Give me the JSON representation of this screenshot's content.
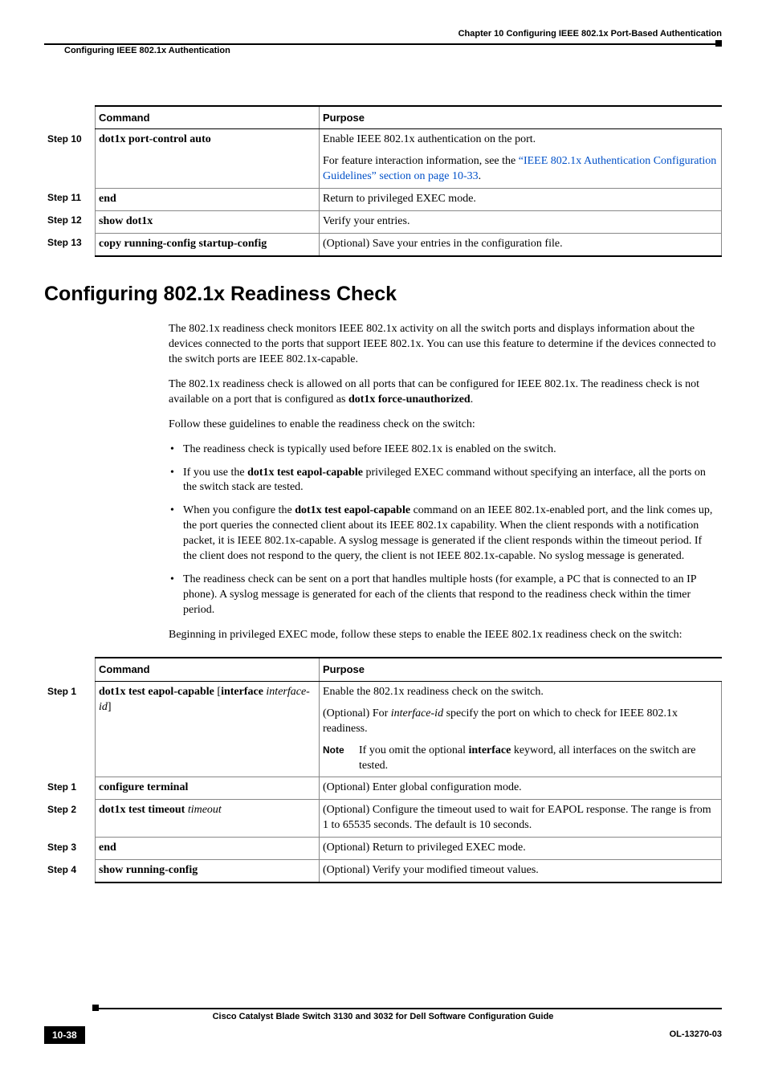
{
  "header": {
    "chapter": "Chapter 10      Configuring IEEE 802.1x Port-Based Authentication",
    "section": "Configuring IEEE 802.1x Authentication"
  },
  "table1": {
    "headers": {
      "command": "Command",
      "purpose": "Purpose"
    },
    "rows": [
      {
        "step": "Step 10",
        "command": "dot1x port-control auto",
        "purpose1": "Enable IEEE 802.1x authentication on the port.",
        "purpose2_a": "For feature interaction information, see the ",
        "purpose2_link": "“IEEE 802.1x Authentication Configuration Guidelines” section on page 10-33",
        "purpose2_b": "."
      },
      {
        "step": "Step 11",
        "command": "end",
        "purpose1": "Return to privileged EXEC mode."
      },
      {
        "step": "Step 12",
        "command": "show dot1x",
        "purpose1": "Verify your entries."
      },
      {
        "step": "Step 13",
        "command": "copy running-config startup-config",
        "purpose1": "(Optional) Save your entries in the configuration file."
      }
    ]
  },
  "section_title": "Configuring 802.1x Readiness Check",
  "body": {
    "p1": "The 802.1x readiness check monitors IEEE 802.1x activity on all the switch ports and displays information about the devices connected to the ports that support IEEE 802.1x. You can use this feature to determine if the devices connected to the switch ports are IEEE 802.1x-capable.",
    "p2_a": "The 802.1x readiness check is allowed on all ports that can be configured for IEEE 802.1x. The readiness check is not available on a port that is configured as ",
    "p2_b": "dot1x force-unauthorized",
    "p2_c": ".",
    "p3": "Follow these guidelines to enable the readiness check on the switch:",
    "b1": "The readiness check is typically used before IEEE 802.1x is enabled on the switch.",
    "b2_a": "If you use the ",
    "b2_b": "dot1x test eapol-capable",
    "b2_c": " privileged EXEC command without specifying an interface, all the ports on the switch stack are tested.",
    "b3_a": "When you configure the ",
    "b3_b": "dot1x test eapol-capable",
    "b3_c": " command on an IEEE 802.1x-enabled port, and the link comes up, the port queries the connected client about its IEEE 802.1x capability. When the client responds with a notification packet, it is IEEE 802.1x-capable. A syslog message is generated if the client responds within the timeout period. If the client does not respond to the query, the client is not IEEE 802.1x-capable. No syslog message is generated.",
    "b4": "The readiness check can be sent on a port that handles multiple hosts (for example, a PC that is connected to an IP phone). A syslog message is generated for each of the clients that respond to the readiness check within the timer period.",
    "p4": "Beginning in privileged EXEC mode, follow these steps to enable the IEEE 802.1x readiness check on the switch:"
  },
  "table2": {
    "headers": {
      "command": "Command",
      "purpose": "Purpose"
    },
    "rows": [
      {
        "step": "Step 1",
        "command_a": "dot1x test eapol-capable ",
        "command_b": "[",
        "command_c": "interface ",
        "command_d": "interface-id",
        "command_e": "]",
        "purpose1": "Enable the 802.1x readiness check on the switch.",
        "purpose2_a": "(Optional) For ",
        "purpose2_b": "interface-id",
        "purpose2_c": " specify the port on which to check for IEEE 802.1x readiness.",
        "note_label": "Note",
        "note_a": "If you omit the optional ",
        "note_b": "interface",
        "note_c": " keyword, all interfaces on the switch are tested."
      },
      {
        "step": "Step 1",
        "command_a": "configure terminal",
        "purpose1": "(Optional) Enter global configuration mode."
      },
      {
        "step": "Step 2",
        "command_a": "dot1x test timeout ",
        "command_d": "timeout",
        "purpose1": "(Optional) Configure the timeout used to wait for EAPOL response. The range is from 1 to 65535 seconds. The default is 10 seconds."
      },
      {
        "step": "Step 3",
        "command_a": "end",
        "purpose1": "(Optional) Return to privileged EXEC mode."
      },
      {
        "step": "Step 4",
        "command_a": "show running-config",
        "purpose1": "(Optional) Verify your modified timeout values."
      }
    ]
  },
  "footer": {
    "title": "Cisco Catalyst Blade Switch 3130 and 3032 for Dell Software Configuration Guide",
    "page": "10-38",
    "docid": "OL-13270-03"
  }
}
